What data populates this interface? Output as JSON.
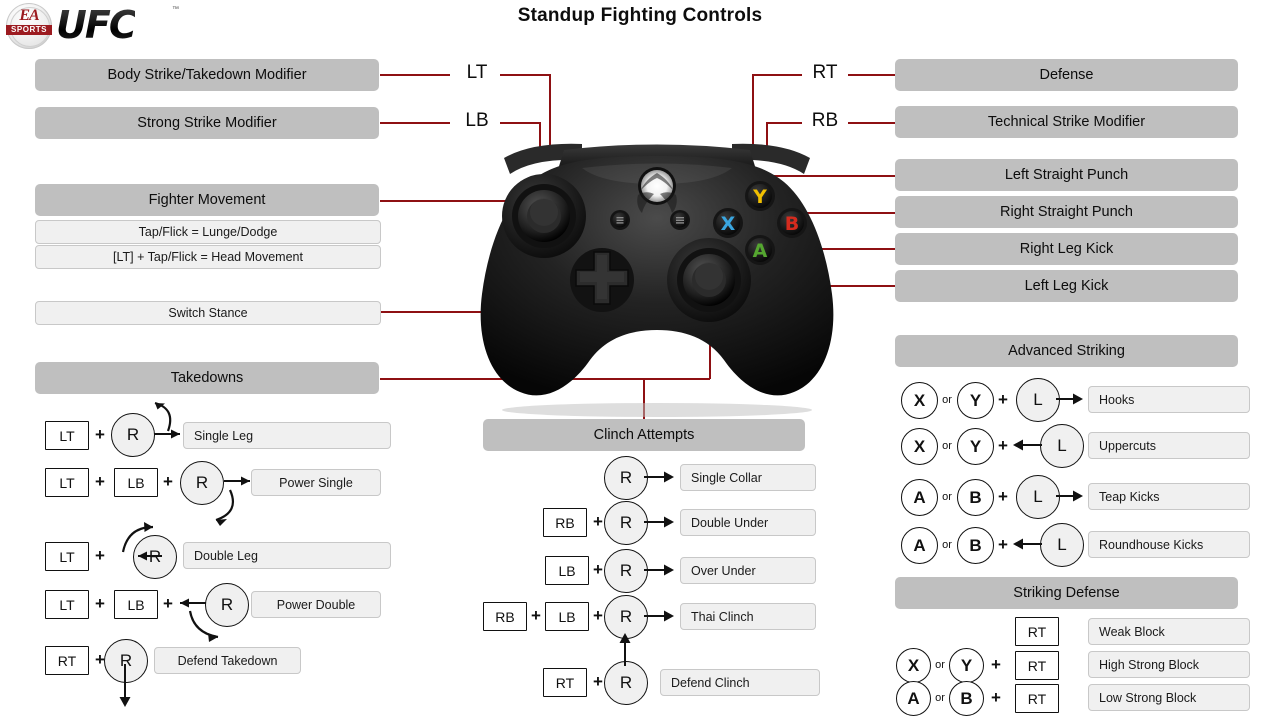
{
  "page": {
    "title": "Standup Fighting Controls",
    "brand": {
      "ea": "EA",
      "sports": "SPORTS",
      "ufc": "UFC",
      "tm": "™"
    },
    "colors": {
      "connector": "#8e1013",
      "header_bar": "#bfbfbf",
      "light_box": "#f0f0f0",
      "x_button": "#3aa6e0",
      "y_button": "#f2c000",
      "b_button": "#d52b1e",
      "a_button": "#55a630"
    }
  },
  "controller": {
    "name": "xbox-one-controller",
    "triggers": {
      "lt": "LT",
      "lb": "LB",
      "rt": "RT",
      "rb": "RB"
    },
    "face_buttons": {
      "x": "X",
      "y": "Y",
      "a": "A",
      "b": "B"
    },
    "sticks": {
      "left": "L",
      "right": "R"
    }
  },
  "left_panel": {
    "modifiers": [
      {
        "label": "Body Strike/Takedown Modifier",
        "binding": "LT"
      },
      {
        "label": "Strong Strike Modifier",
        "binding": "LB"
      }
    ],
    "fighter_movement": {
      "header": "Fighter Movement",
      "rows": [
        "Tap/Flick = Lunge/Dodge",
        "[LT] + Tap/Flick = Head Movement"
      ]
    },
    "switch_stance": "Switch Stance",
    "takedowns": {
      "header": "Takedowns",
      "rows": [
        {
          "inputs": [
            "LT"
          ],
          "stick": "R",
          "motion": "up-curve",
          "result": "Single Leg"
        },
        {
          "inputs": [
            "LT",
            "LB"
          ],
          "stick": "R",
          "motion": "down-curve",
          "result": "Power Single"
        },
        {
          "inputs": [
            "LT"
          ],
          "stick": "R",
          "motion": "left-up-curve",
          "result": "Double Leg"
        },
        {
          "inputs": [
            "LT",
            "LB"
          ],
          "stick": "R",
          "motion": "left-down-curve",
          "result": "Power Double"
        },
        {
          "inputs": [
            "RT"
          ],
          "stick": "R",
          "motion": "down",
          "result": "Defend Takedown"
        }
      ]
    }
  },
  "center_panel": {
    "clinch": {
      "header": "Clinch Attempts",
      "rows": [
        {
          "inputs": [],
          "stick": "R",
          "motion": "right",
          "result": "Single Collar"
        },
        {
          "inputs": [
            "RB"
          ],
          "stick": "R",
          "motion": "right",
          "result": "Double Under"
        },
        {
          "inputs": [
            "LB"
          ],
          "stick": "R",
          "motion": "right",
          "result": "Over Under"
        },
        {
          "inputs": [
            "RB",
            "LB"
          ],
          "stick": "R",
          "motion": "right",
          "result": "Thai Clinch"
        },
        {
          "inputs": [
            "RT"
          ],
          "stick": "R",
          "motion": "up",
          "result": "Defend Clinch"
        }
      ]
    }
  },
  "right_panel": {
    "modifiers": [
      {
        "label": "Defense",
        "binding": "RT"
      },
      {
        "label": "Technical Strike Modifier",
        "binding": "RB"
      }
    ],
    "strikes": [
      {
        "label": "Left Straight Punch",
        "binding": "X"
      },
      {
        "label": "Right Straight Punch",
        "binding": "Y"
      },
      {
        "label": "Right Leg Kick",
        "binding": "B"
      },
      {
        "label": "Left Leg Kick",
        "binding": "A"
      }
    ],
    "advanced_striking": {
      "header": "Advanced Striking",
      "rows": [
        {
          "buttons": [
            "X",
            "Y"
          ],
          "or": "or",
          "stick": "L",
          "motion": "right",
          "result": "Hooks"
        },
        {
          "buttons": [
            "X",
            "Y"
          ],
          "or": "or",
          "stick": "L",
          "motion": "left",
          "result": "Uppercuts"
        },
        {
          "buttons": [
            "A",
            "B"
          ],
          "or": "or",
          "stick": "L",
          "motion": "right",
          "result": "Teap Kicks"
        },
        {
          "buttons": [
            "A",
            "B"
          ],
          "or": "or",
          "stick": "L",
          "motion": "left",
          "result": "Roundhouse  Kicks"
        }
      ]
    },
    "striking_defense": {
      "header": "Striking Defense",
      "rows": [
        {
          "buttons": [],
          "or": "",
          "trigger": "RT",
          "result": "Weak Block"
        },
        {
          "buttons": [
            "X",
            "Y"
          ],
          "or": "or",
          "trigger": "RT",
          "result": "High Strong  Block"
        },
        {
          "buttons": [
            "A",
            "B"
          ],
          "or": "or",
          "trigger": "RT",
          "result": "Low Strong  Block"
        }
      ]
    }
  },
  "symbols": {
    "plus": "+",
    "arrow": "→"
  }
}
